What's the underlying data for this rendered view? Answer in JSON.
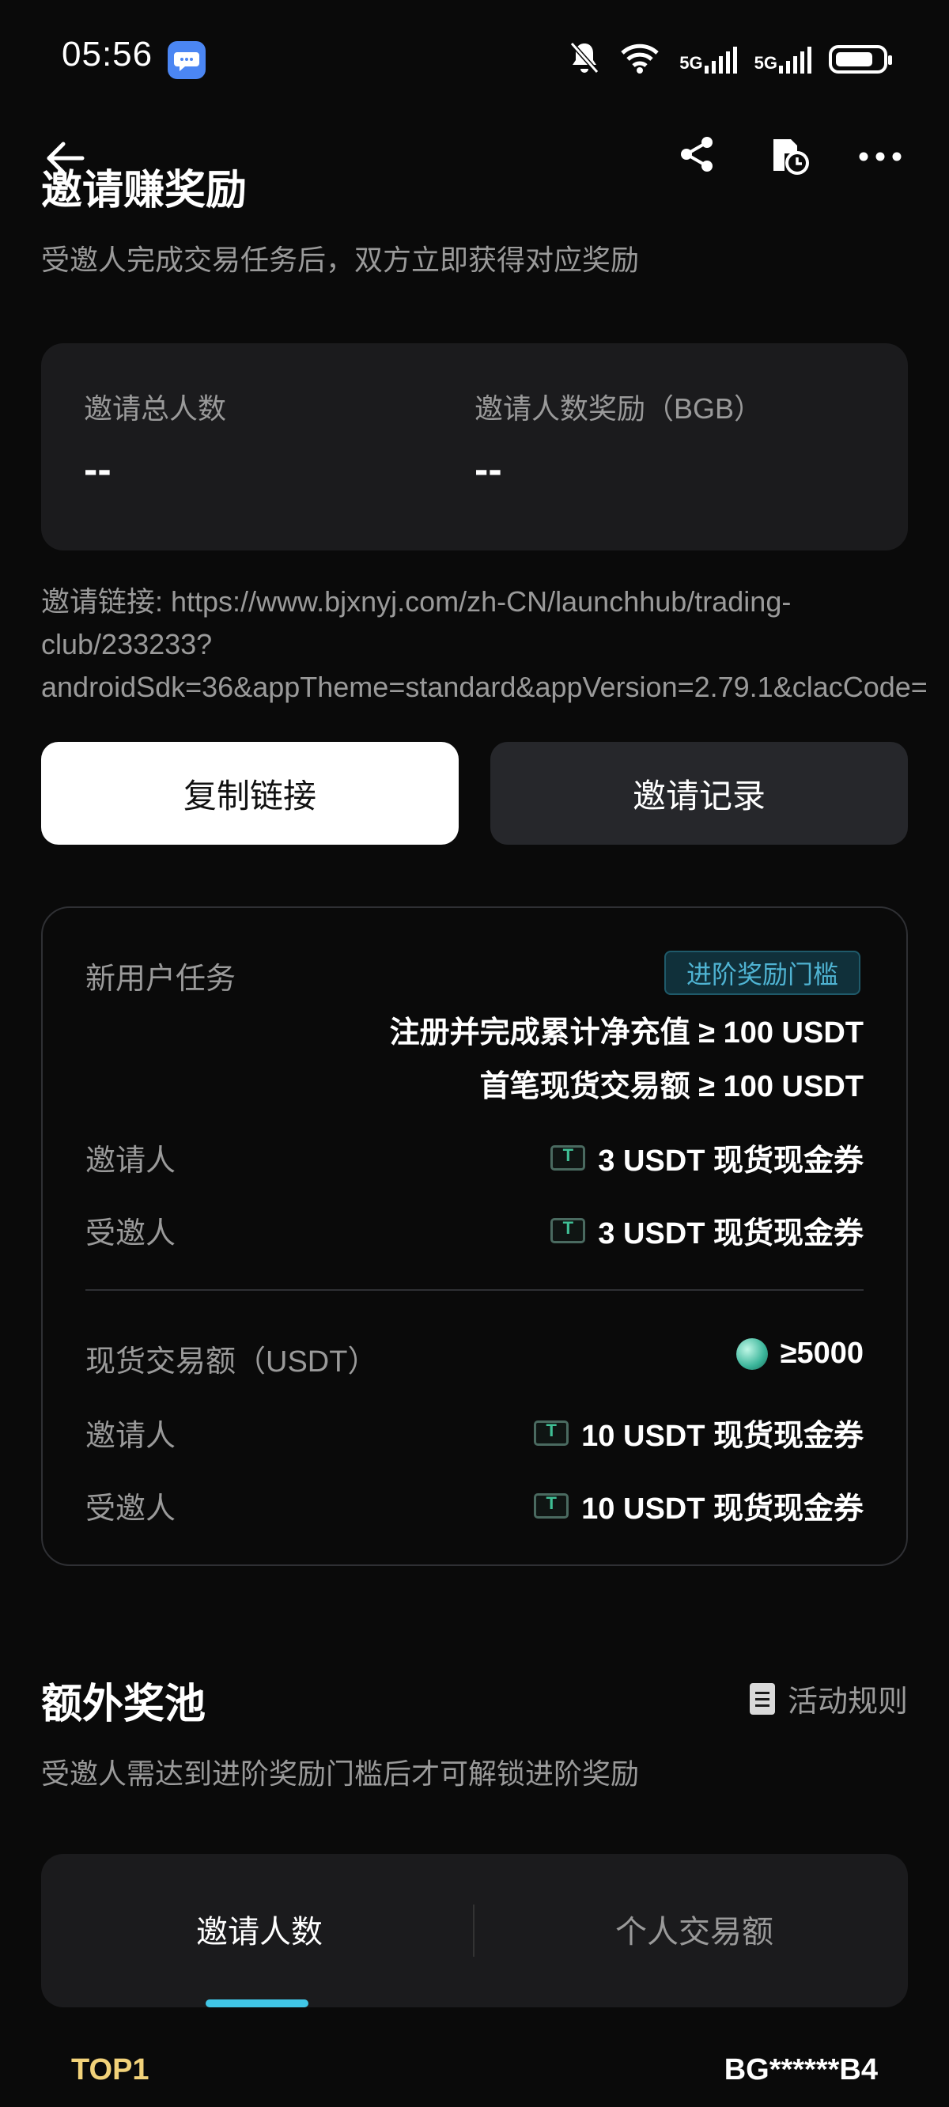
{
  "status_bar": {
    "time": "05:56",
    "net1": "5G",
    "net2": "5G",
    "wifi_label": "6"
  },
  "header": {
    "title": "邀请赚奖励",
    "subtitle": "受邀人完成交易任务后，双方立即获得对应奖励"
  },
  "stats": {
    "total_label": "邀请总人数",
    "total_value": "--",
    "reward_label": "邀请人数奖励（BGB）",
    "reward_value": "--"
  },
  "invite": {
    "link_text": "邀请链接: https://www.bjxnyj.com/zh-CN/launchhub/trading-\nclub/233233?\nandroidSdk=36&appTheme=standard&appVersion=2.79.1&clacCode=",
    "copy_button": "复制链接",
    "record_button": "邀请记录"
  },
  "task_card": {
    "title": "新用户任务",
    "badge": "进阶奖励门槛",
    "condition_1": "注册并完成累计净充值 ≥ 100 USDT",
    "condition_2": "首笔现货交易额 ≥ 100 USDT",
    "row1_label": "邀请人",
    "row1_value": "3 USDT 现货现金券",
    "row2_label": "受邀人",
    "row2_value": "3 USDT 现货现金券",
    "spot_label": "现货交易额（USDT）",
    "spot_value": "≥5000",
    "row3_label": "邀请人",
    "row3_value": "10 USDT 现货现金券",
    "row4_label": "受邀人",
    "row4_value": "10 USDT 现货现金券"
  },
  "pool": {
    "title": "额外奖池",
    "rules_link": "活动规则",
    "desc": "受邀人需达到进阶奖励门槛后才可解锁进阶奖励",
    "tabs": [
      {
        "label": "邀请人数"
      },
      {
        "label": "个人交易额"
      }
    ]
  },
  "ranking": {
    "rank": "TOP1",
    "user": "BG******B4"
  },
  "colors": {
    "accent": "#41c6e6",
    "badge_text": "#4fb3d2",
    "rank_gold": "#f2d27a"
  }
}
